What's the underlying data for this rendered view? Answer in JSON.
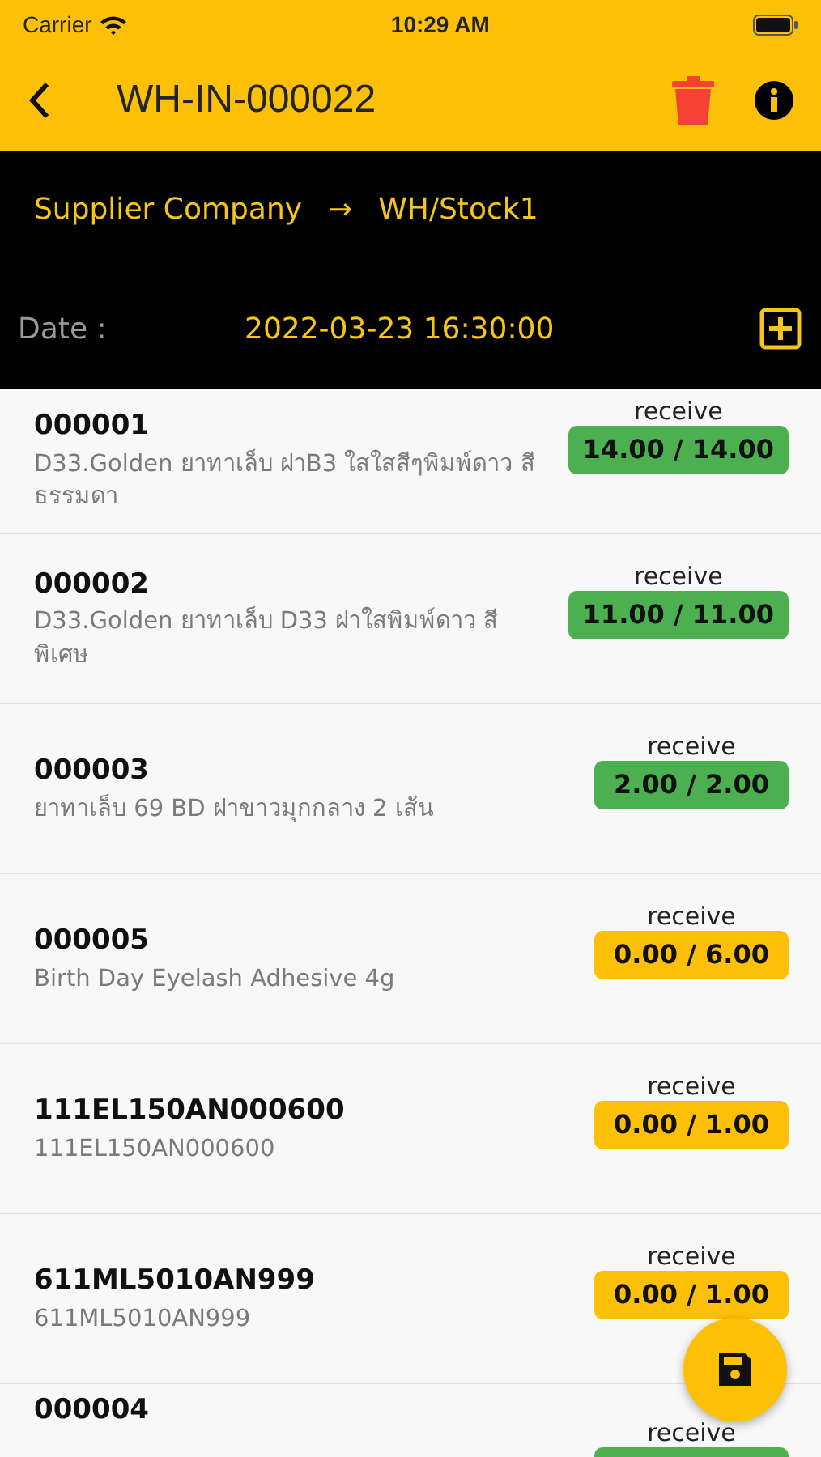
{
  "status_bar": {
    "carrier": "Carrier",
    "time": "10:29 AM"
  },
  "nav": {
    "title": "WH-IN-000022"
  },
  "route": {
    "from": "Supplier Company",
    "arrow": "→",
    "to": "WH/Stock1"
  },
  "date": {
    "label": "Date :",
    "value": "2022-03-23 16:30:00"
  },
  "items": [
    {
      "code": "000001",
      "description": "D33.Golden ยาทาเล็บ ฝาB3 ใสใสสีๆพิมพ์ดาว สีธรรมดา",
      "label": "receive",
      "quantity": "14.00 / 14.00",
      "color": "#4caf50"
    },
    {
      "code": "000002",
      "description": "D33.Golden ยาทาเล็บ D33 ฝาใสพิมพ์ดาว สี พิเศษ",
      "label": "receive",
      "quantity": "11.00 / 11.00",
      "color": "#4caf50"
    },
    {
      "code": "000003",
      "description": "ยาทาเล็บ 69 BD ฝาขาวมุกกลาง 2 เส้น",
      "label": "receive",
      "quantity": "2.00 / 2.00",
      "color": "#4caf50"
    },
    {
      "code": "000005",
      "description": "Birth Day  Eyelash Adhesive 4g",
      "label": "receive",
      "quantity": "0.00 / 6.00",
      "color": "#fec007"
    },
    {
      "code": "111EL150AN000600",
      "description": "111EL150AN000600",
      "label": "receive",
      "quantity": "0.00 / 1.00",
      "color": "#fec007"
    },
    {
      "code": "611ML5010AN999",
      "description": "611ML5010AN999",
      "label": "receive",
      "quantity": "0.00 / 1.00",
      "color": "#fec007"
    },
    {
      "code": "000004",
      "label": "receive",
      "color": "#4caf50"
    }
  ]
}
